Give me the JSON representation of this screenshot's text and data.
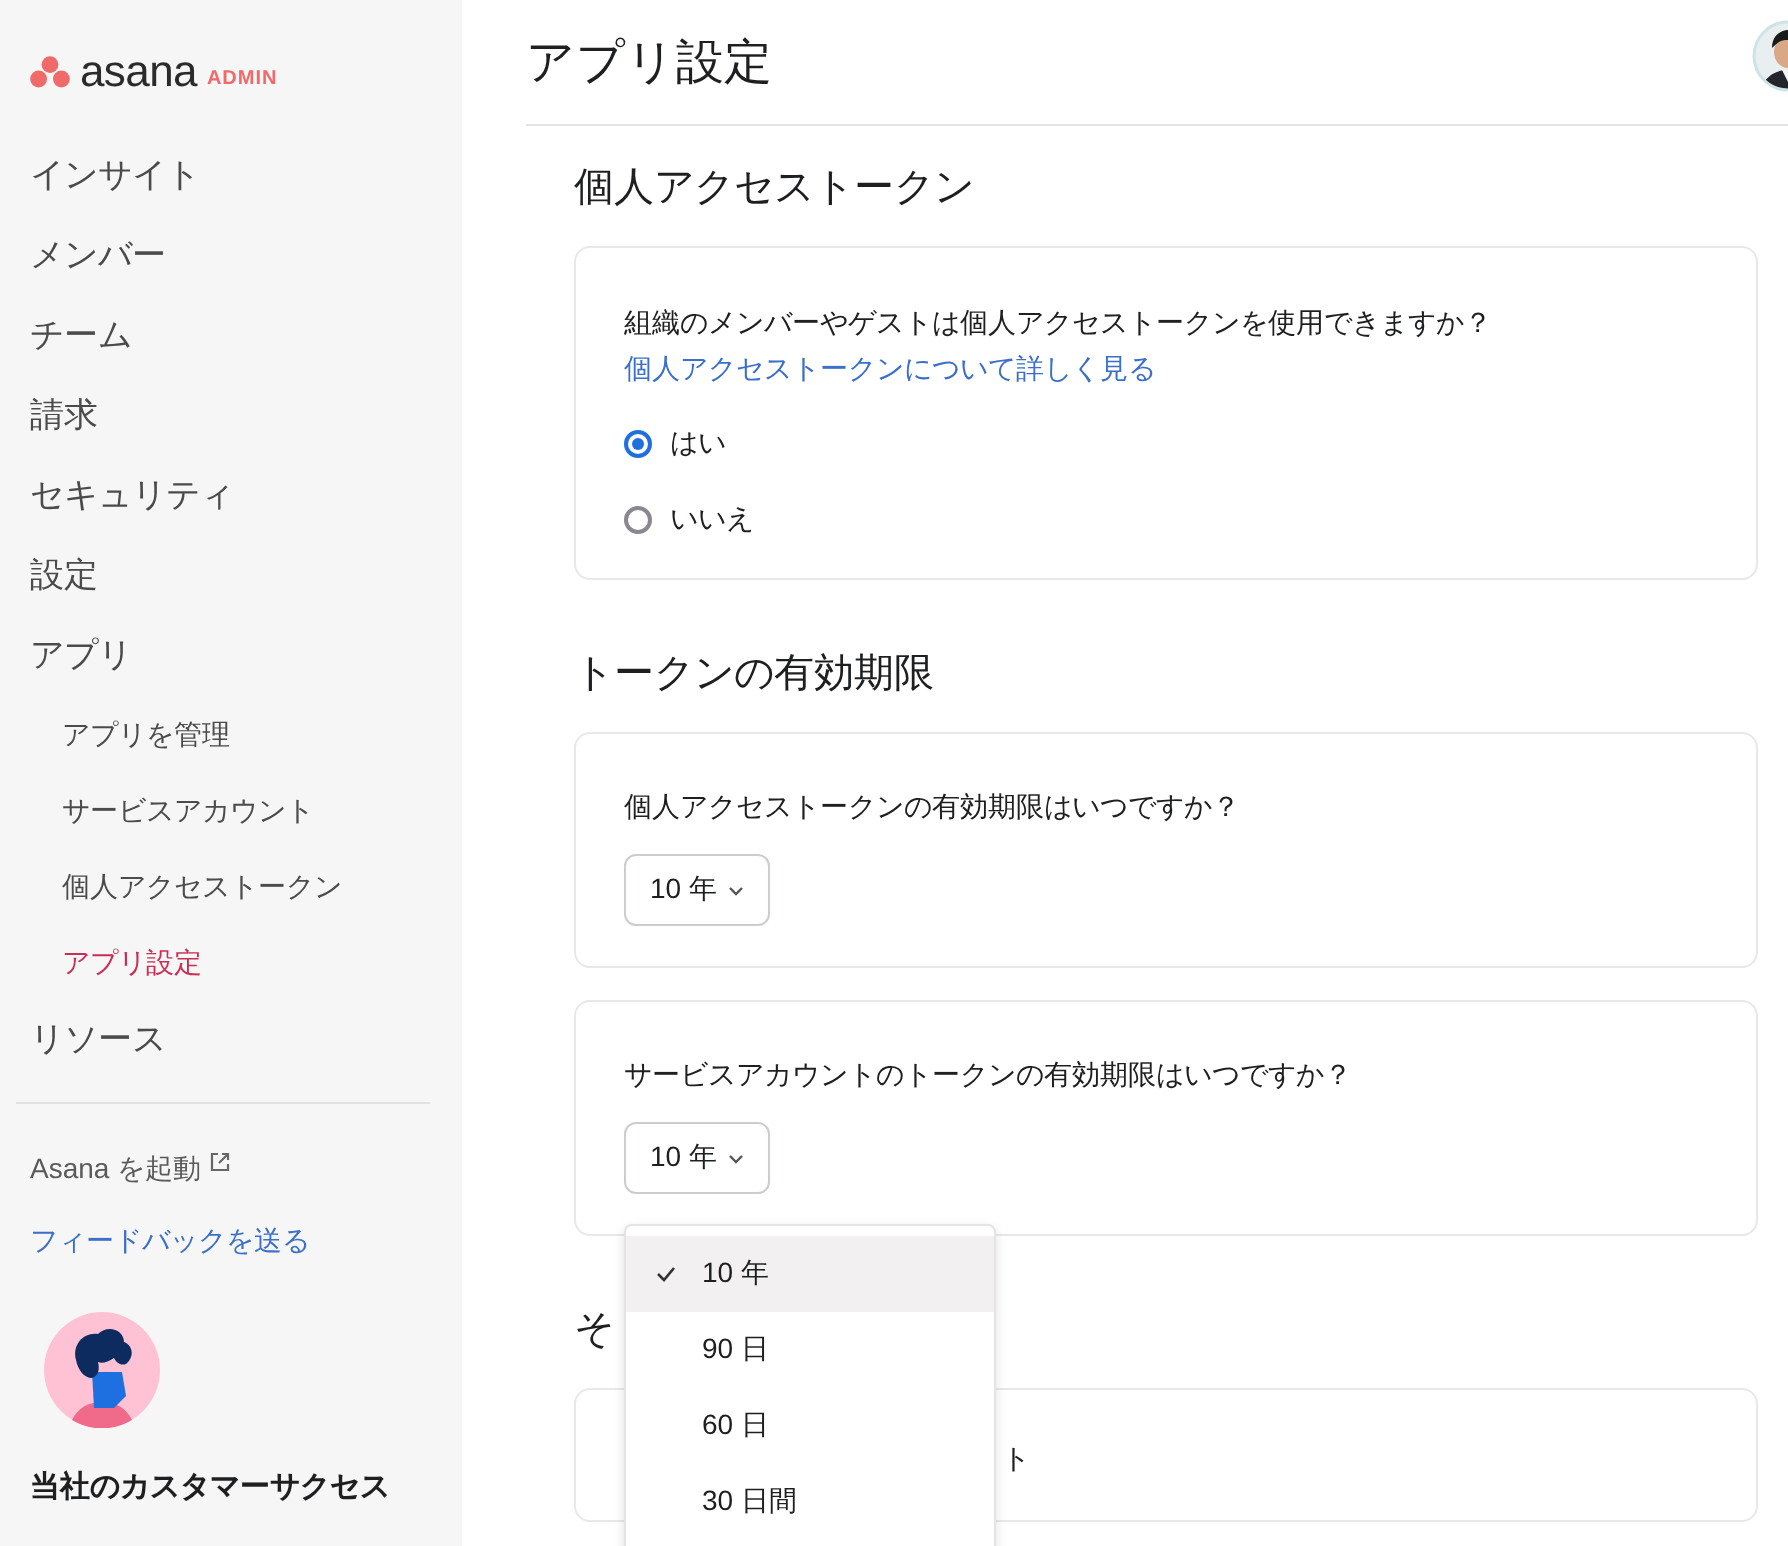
{
  "sidebar": {
    "logo": "asana",
    "badge": "ADMIN",
    "items": [
      {
        "label": "インサイト",
        "selected": false
      },
      {
        "label": "メンバー",
        "selected": false
      },
      {
        "label": "チーム",
        "selected": false
      },
      {
        "label": "請求",
        "selected": false
      },
      {
        "label": "セキュリティ",
        "selected": false
      },
      {
        "label": "設定",
        "selected": false
      },
      {
        "label": "アプリ",
        "selected": false,
        "children": [
          {
            "label": "アプリを管理",
            "selected": false
          },
          {
            "label": "サービスアカウント",
            "selected": false
          },
          {
            "label": "個人アクセストークン",
            "selected": false
          },
          {
            "label": "アプリ設定",
            "selected": true
          }
        ]
      },
      {
        "label": "リソース",
        "selected": false
      }
    ],
    "links": [
      {
        "label": "Asana を起動",
        "kind": "external"
      },
      {
        "label": "フィードバックを送る",
        "kind": "link"
      }
    ],
    "promo": {
      "text": "当社のカスタマーサクセス"
    }
  },
  "header": {
    "title": "アプリ設定"
  },
  "sections": [
    {
      "title": "個人アクセストークン",
      "cards": [
        {
          "kind": "radio",
          "question": "組織のメンバーやゲストは個人アクセストークンを使用できますか？",
          "link": "個人アクセストークンについて詳しく見る",
          "options": [
            {
              "label": "はい",
              "selected": true
            },
            {
              "label": "いいえ",
              "selected": false
            }
          ]
        }
      ]
    },
    {
      "title": "トークンの有効期限",
      "cards": [
        {
          "kind": "select",
          "question": "個人アクセストークンの有効期限はいつですか？",
          "value": "10 年"
        },
        {
          "kind": "select",
          "question": "サービスアカウントのトークンの有効期限はいつですか？",
          "value": "10 年",
          "open": true
        }
      ]
    },
    {
      "title": "そ",
      "cards": [
        {
          "kind": "text",
          "lines": [
            "ト"
          ]
        }
      ]
    }
  ],
  "dropdown": {
    "options": [
      {
        "label": "10 年",
        "selected": true
      },
      {
        "label": "90 日",
        "selected": false
      },
      {
        "label": "60 日",
        "selected": false
      },
      {
        "label": "30 日間",
        "selected": false
      }
    ]
  }
}
